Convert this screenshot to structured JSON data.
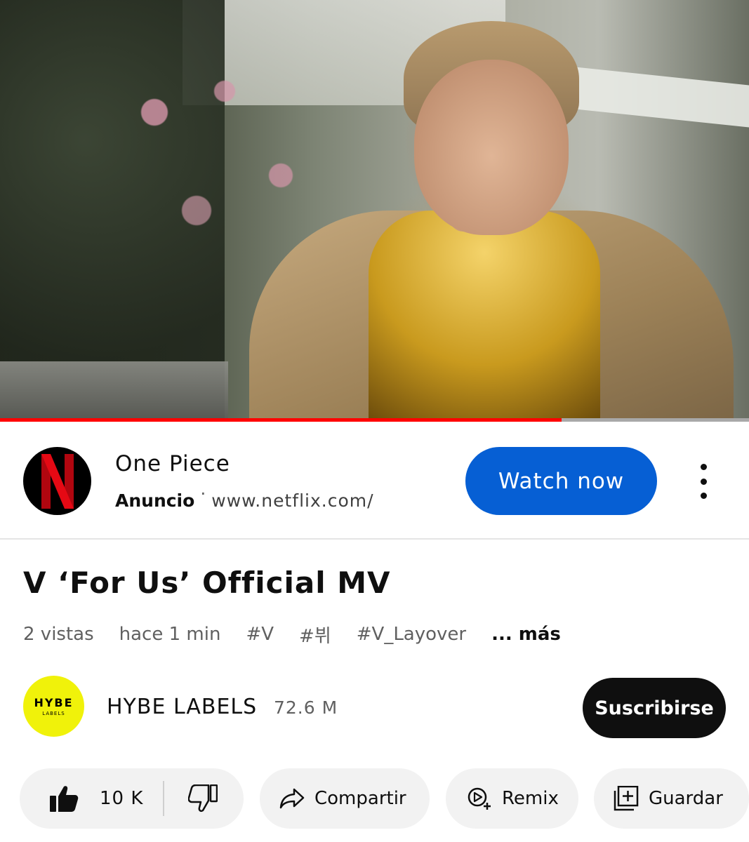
{
  "player": {
    "progress_fraction": 0.75,
    "progress_color": "#ff0000",
    "thumbnail_description_icon": "video-frame"
  },
  "ad": {
    "logo_letter": "N",
    "logo_color": "#e50914",
    "title": "One Piece",
    "sponsor_label": "Anuncio",
    "separator": "·",
    "url": "www.netflix.com/",
    "cta_label": "Watch now",
    "cta_color": "#065fd4",
    "menu_icon": "more-vertical-icon"
  },
  "video": {
    "title": "V ‘For Us’ Official MV",
    "views": "2 vistas",
    "age": "hace 1 min",
    "hashtags": [
      "#V",
      "#뷔",
      "#V_Layover"
    ],
    "more_label": "... más"
  },
  "channel": {
    "avatar_text": "HYBE",
    "avatar_subtext": "LABELS",
    "avatar_color": "#f0f20a",
    "name": "HYBE LABELS",
    "subscribers": "72.6 M",
    "subscribe_label": "Suscribirse"
  },
  "actions": {
    "like_count": "10 K",
    "like_icon": "thumbs-up-icon",
    "dislike_icon": "thumbs-down-icon",
    "share_label": "Compartir",
    "share_icon": "share-icon",
    "remix_label": "Remix",
    "remix_icon": "remix-icon",
    "save_label": "Guardar",
    "save_icon": "add-to-playlist-icon"
  }
}
